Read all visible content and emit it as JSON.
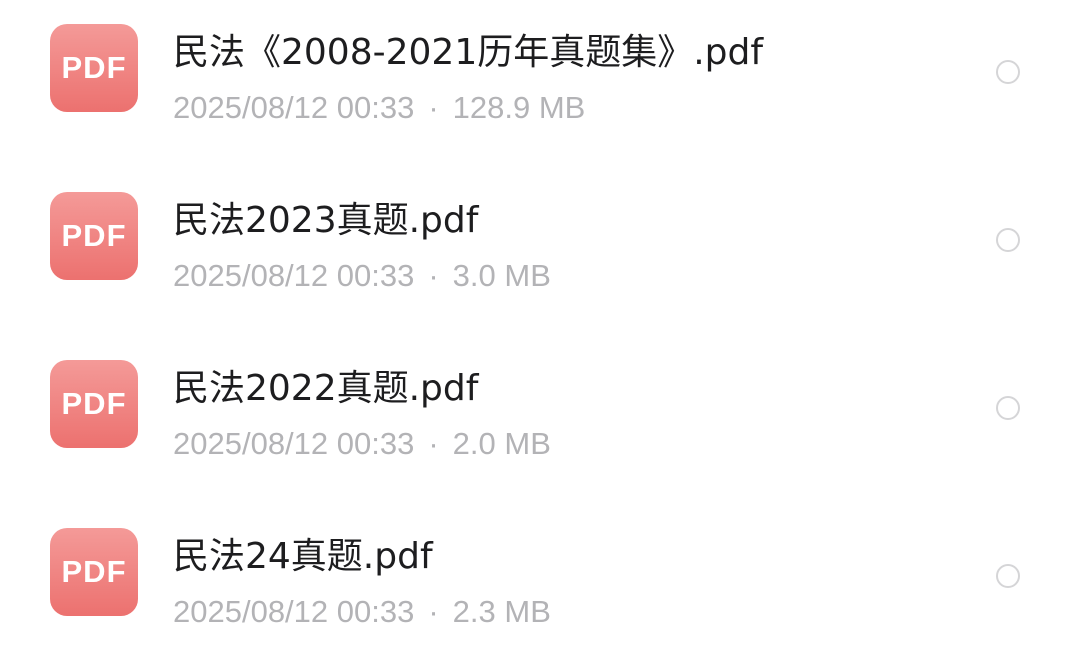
{
  "files": [
    {
      "icon_label": "PDF",
      "name": "民法《2008-2021历年真题集》.pdf",
      "date": "2025/08/12 00:33",
      "separator": "·",
      "size": "128.9 MB"
    },
    {
      "icon_label": "PDF",
      "name": "民法2023真题.pdf",
      "date": "2025/08/12 00:33",
      "separator": "·",
      "size": "3.0 MB"
    },
    {
      "icon_label": "PDF",
      "name": "民法2022真题.pdf",
      "date": "2025/08/12 00:33",
      "separator": "·",
      "size": "2.0 MB"
    },
    {
      "icon_label": "PDF",
      "name": "民法24真题.pdf",
      "date": "2025/08/12 00:33",
      "separator": "·",
      "size": "2.3 MB"
    }
  ],
  "colors": {
    "pdf_icon_top": "#f49a98",
    "pdf_icon_bottom": "#ec716f",
    "name_text": "#1d1d1f",
    "meta_text": "#b3b3b6",
    "radio_border": "#d5d5d7"
  }
}
